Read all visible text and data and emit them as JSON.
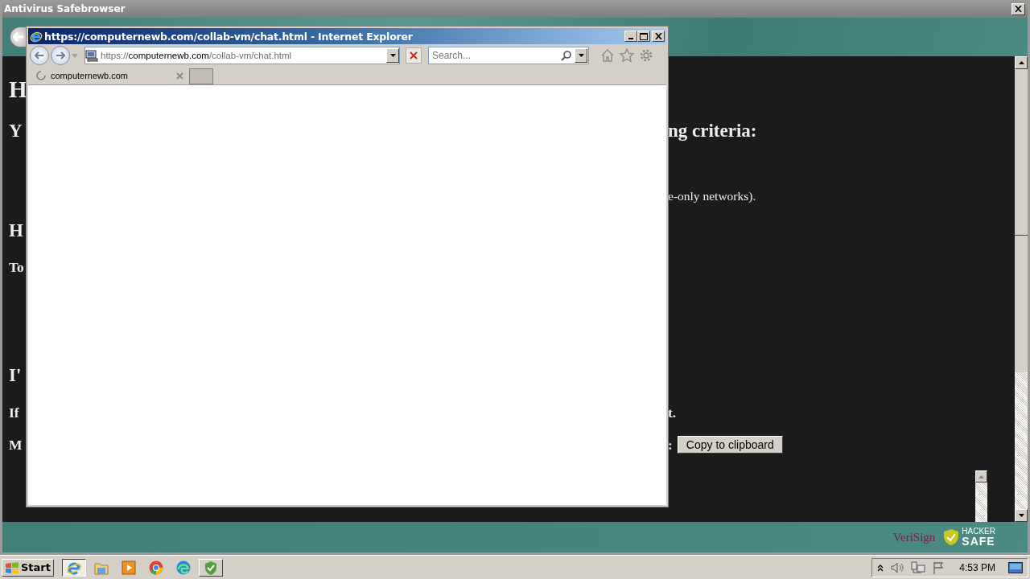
{
  "app": {
    "title": "Antivirus Safebrowser",
    "lines": [
      {
        "kind": "h1",
        "left": "H"
      },
      {
        "kind": "h2",
        "left": "Y",
        "right": "ng criteria:"
      },
      {
        "kind": "p",
        "right": "e-only networks)."
      },
      {
        "kind": "h2",
        "left": "H"
      },
      {
        "kind": "strong",
        "left": "To"
      },
      {
        "kind": "h2",
        "left": "I'"
      },
      {
        "kind": "strong",
        "left": "If",
        "right": "t."
      },
      {
        "kind": "strong",
        "left": "M",
        "right": ":",
        "button": "Copy to clipboard"
      }
    ],
    "footer": {
      "verisign": "VeriSign",
      "hacker": "HACKER",
      "safe": "SAFE"
    }
  },
  "browser": {
    "title": "https://computernewb.com/collab-vm/chat.html - Internet Explorer",
    "address": {
      "scheme": "https://",
      "host": "computernewb.com",
      "path": "/collab-vm/chat.html"
    },
    "search": {
      "placeholder": "Search..."
    },
    "tabs": [
      {
        "label": "computernewb.com",
        "selected": true
      }
    ]
  },
  "taskbar": {
    "start": "Start",
    "apps": [
      {
        "kind": "ie",
        "selected": true
      },
      {
        "kind": "folder",
        "selected": false
      },
      {
        "kind": "media",
        "selected": false
      },
      {
        "kind": "chrome",
        "selected": false
      },
      {
        "kind": "edge",
        "selected": false
      },
      {
        "kind": "shield",
        "selected": false
      }
    ],
    "clock": "4:53 PM"
  }
}
